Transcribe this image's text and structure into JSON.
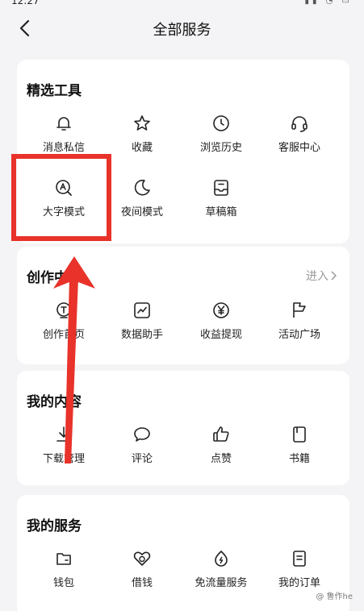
{
  "header": {
    "title": "全部服务"
  },
  "sections": [
    {
      "title": "精选工具",
      "items": [
        {
          "label": "消息私信",
          "icon": "bell-icon"
        },
        {
          "label": "收藏",
          "icon": "star-icon"
        },
        {
          "label": "浏览历史",
          "icon": "clock-icon"
        },
        {
          "label": "客服中心",
          "icon": "headset-icon"
        },
        {
          "label": "大字模式",
          "icon": "large-font-icon"
        },
        {
          "label": "夜间模式",
          "icon": "moon-icon"
        },
        {
          "label": "草稿箱",
          "icon": "draft-box-icon"
        }
      ]
    },
    {
      "title": "创作中心",
      "enter_label": "进入",
      "items": [
        {
          "label": "创作首页",
          "icon": "creator-home-icon"
        },
        {
          "label": "数据助手",
          "icon": "data-chart-icon"
        },
        {
          "label": "收益提现",
          "icon": "yuan-coin-icon"
        },
        {
          "label": "活动广场",
          "icon": "flag-icon"
        }
      ]
    },
    {
      "title": "我的内容",
      "items": [
        {
          "label": "下载管理",
          "icon": "download-icon"
        },
        {
          "label": "评论",
          "icon": "comment-icon"
        },
        {
          "label": "点赞",
          "icon": "thumbs-up-icon"
        },
        {
          "label": "书籍",
          "icon": "book-icon"
        }
      ]
    },
    {
      "title": "我的服务",
      "items": [
        {
          "label": "钱包",
          "icon": "wallet-icon"
        },
        {
          "label": "借钱",
          "icon": "loan-icon"
        },
        {
          "label": "免流量服务",
          "icon": "free-data-icon"
        },
        {
          "label": "我的订单",
          "icon": "order-icon"
        }
      ]
    }
  ],
  "annotation": {
    "highlight_color": "#e8322a"
  },
  "watermark": {
    "text": "@ 鲁作he"
  }
}
